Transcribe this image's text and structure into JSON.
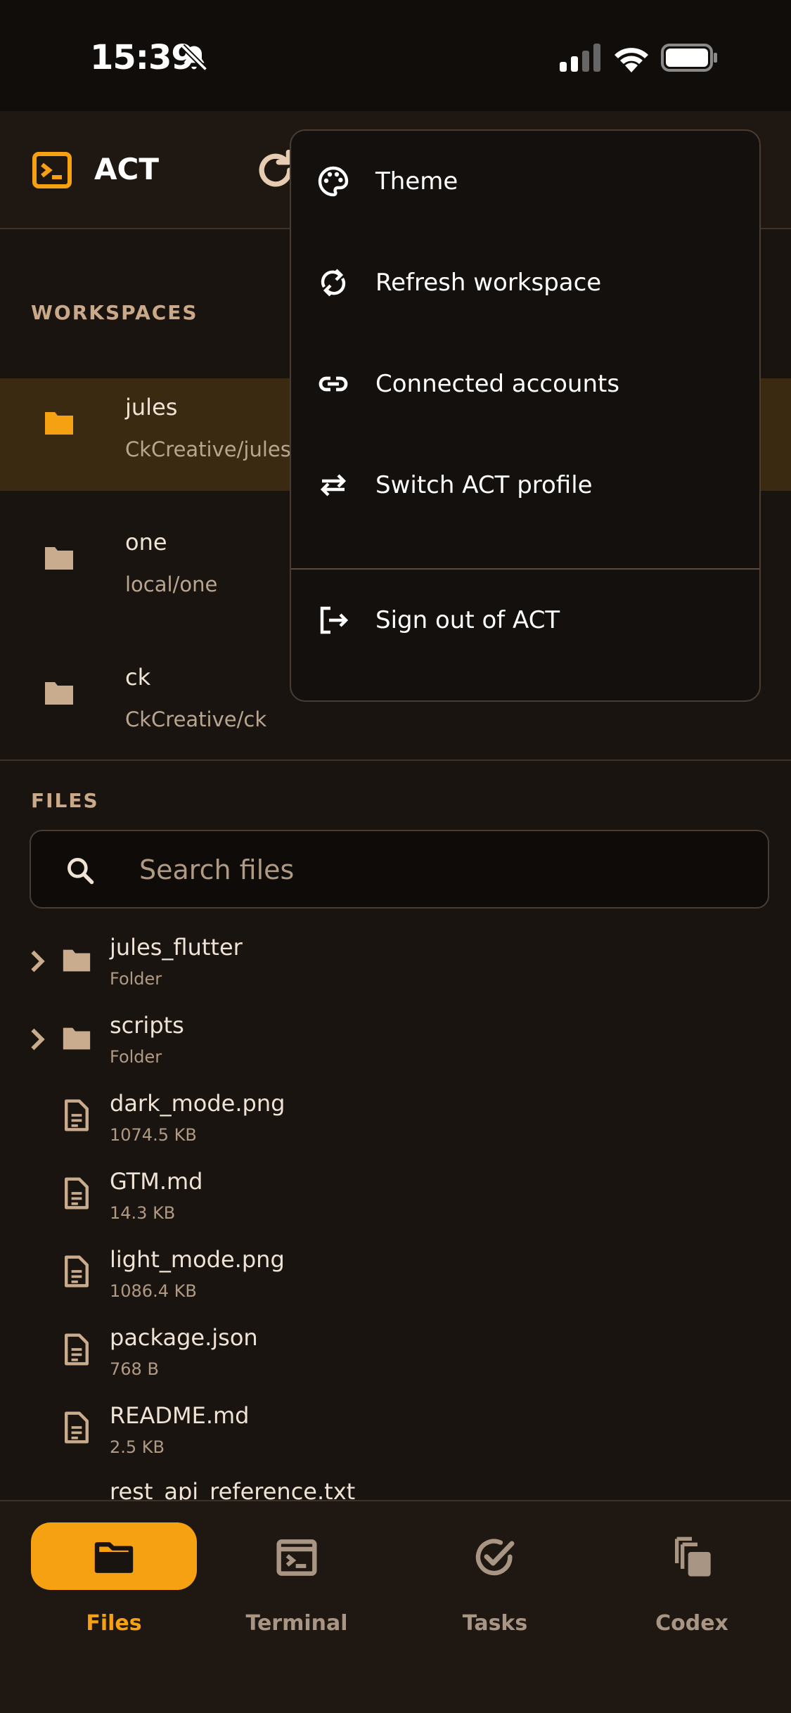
{
  "status_bar": {
    "time": "15:39"
  },
  "app_bar": {
    "title": "ACT"
  },
  "workspaces": {
    "label": "WORKSPACES",
    "items": [
      {
        "name": "jules",
        "path": "CkCreative/jules"
      },
      {
        "name": "one",
        "path": "local/one"
      },
      {
        "name": "ck",
        "path": "CkCreative/ck"
      }
    ]
  },
  "files": {
    "label": "FILES",
    "search_placeholder": "Search files",
    "items": [
      {
        "name": "jules_flutter",
        "meta": "Folder",
        "kind": "folder"
      },
      {
        "name": "scripts",
        "meta": "Folder",
        "kind": "folder"
      },
      {
        "name": "dark_mode.png",
        "meta": "1074.5 KB",
        "kind": "file"
      },
      {
        "name": "GTM.md",
        "meta": "14.3 KB",
        "kind": "file"
      },
      {
        "name": "light_mode.png",
        "meta": "1086.4 KB",
        "kind": "file"
      },
      {
        "name": "package.json",
        "meta": "768 B",
        "kind": "file"
      },
      {
        "name": "README.md",
        "meta": "2.5 KB",
        "kind": "file"
      },
      {
        "name": "rest_api_reference.txt",
        "meta": "",
        "kind": "file"
      }
    ]
  },
  "menu": {
    "items": [
      {
        "label": "Theme",
        "icon": "palette-icon"
      },
      {
        "label": "Refresh workspace",
        "icon": "sync-icon"
      },
      {
        "label": "Connected accounts",
        "icon": "link-icon"
      },
      {
        "label": "Switch ACT profile",
        "icon": "swap-icon"
      },
      {
        "label": "Sign out of ACT",
        "icon": "logout-icon"
      }
    ]
  },
  "nav": {
    "items": [
      {
        "label": "Files",
        "icon": "folder-icon",
        "active": true
      },
      {
        "label": "Terminal",
        "icon": "terminal-icon",
        "active": false
      },
      {
        "label": "Tasks",
        "icon": "check-circle-icon",
        "active": false
      },
      {
        "label": "Codex",
        "icon": "copy-icon",
        "active": false
      }
    ]
  },
  "colors": {
    "accent": "#f5a112",
    "background": "#1a1410",
    "selected_row": "#3a2a12",
    "muted_text": "#b09a84"
  }
}
